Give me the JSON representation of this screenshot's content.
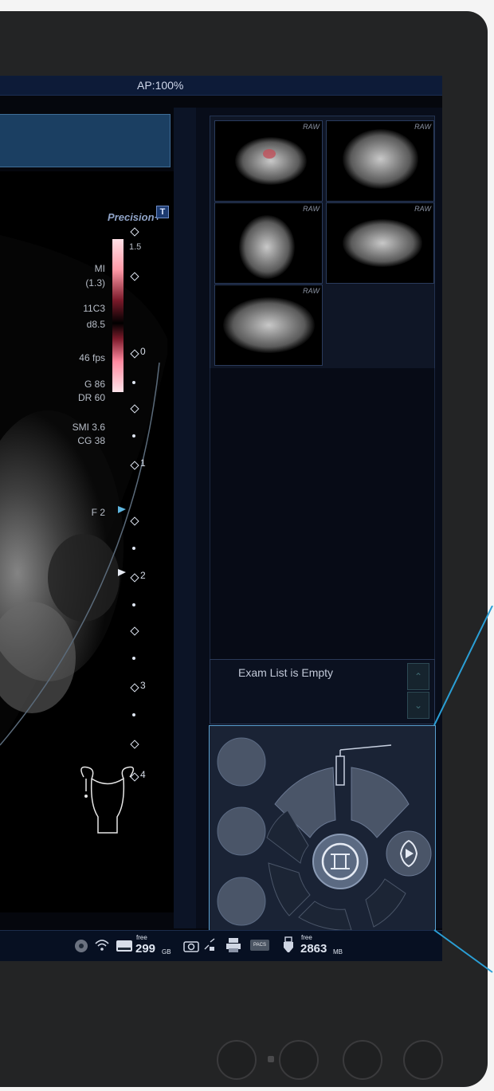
{
  "topbar": {
    "acoustic_power": "AP:100%"
  },
  "image": {
    "brand": "Precision+",
    "t_button": "T",
    "params": [
      "MI",
      "(1.3)",
      "11C3",
      "d8.5",
      "46 fps",
      "G 86",
      "DR 60",
      "SMI 3.6",
      "CG 38",
      "F 2"
    ],
    "colorbar": {
      "top": "1.5",
      "mid": "0"
    },
    "depth_labels": [
      "0",
      "1",
      "2",
      "3",
      "4"
    ]
  },
  "thumbnails": [
    {
      "label": "RAW"
    },
    {
      "label": "RAW"
    },
    {
      "label": "RAW"
    },
    {
      "label": "RAW"
    },
    {
      "label": "RAW"
    }
  ],
  "exam_list": {
    "message": "Exam List is Empty",
    "up_icon": "chevron-up-icon",
    "down_icon": "chevron-down-icon"
  },
  "status": {
    "disk_free_label": "free",
    "disk_free_value": "299",
    "disk_free_unit": "GB",
    "memory_free_label": "free",
    "memory_free_value": "2863",
    "memory_free_unit": "MB",
    "pacs_label": "PACS"
  },
  "colors": {
    "accent": "#5aa0d0",
    "screen_bg": "#05070d",
    "panel": "#1a2335",
    "topbar": "#0d1b38"
  }
}
